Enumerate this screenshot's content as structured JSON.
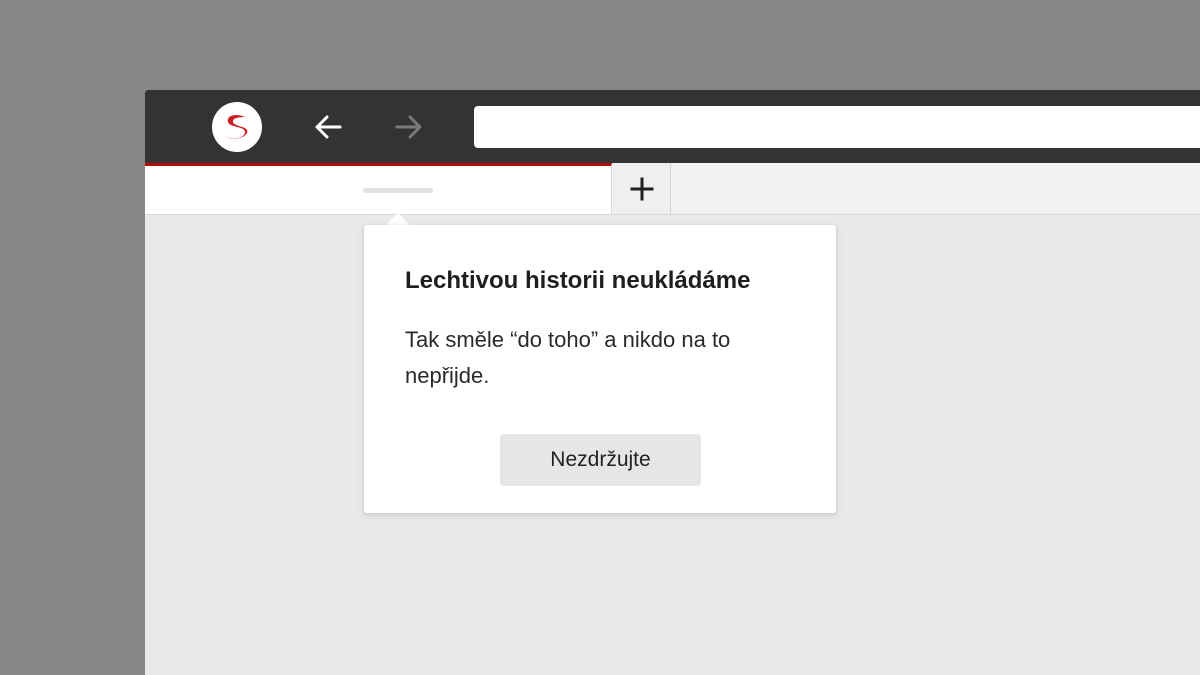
{
  "browser": {
    "logo_icon": "seznam-s-logo-icon",
    "brand_color": "#cc2027",
    "toolbar_color": "#333333",
    "accent_color": "#b30b0b",
    "back_icon": "arrow-left-icon",
    "forward_icon": "arrow-right-icon",
    "forward_enabled": false,
    "address_bar": {
      "value": "",
      "placeholder": ""
    }
  },
  "tabs": {
    "active_tab_title": "",
    "new_tab_icon": "plus-icon"
  },
  "popover": {
    "title": "Lechtivou historii neukládáme",
    "text": "Tak směle “do toho” a nikdo na to nepřijde.",
    "button_label": "Nezdržujte"
  }
}
